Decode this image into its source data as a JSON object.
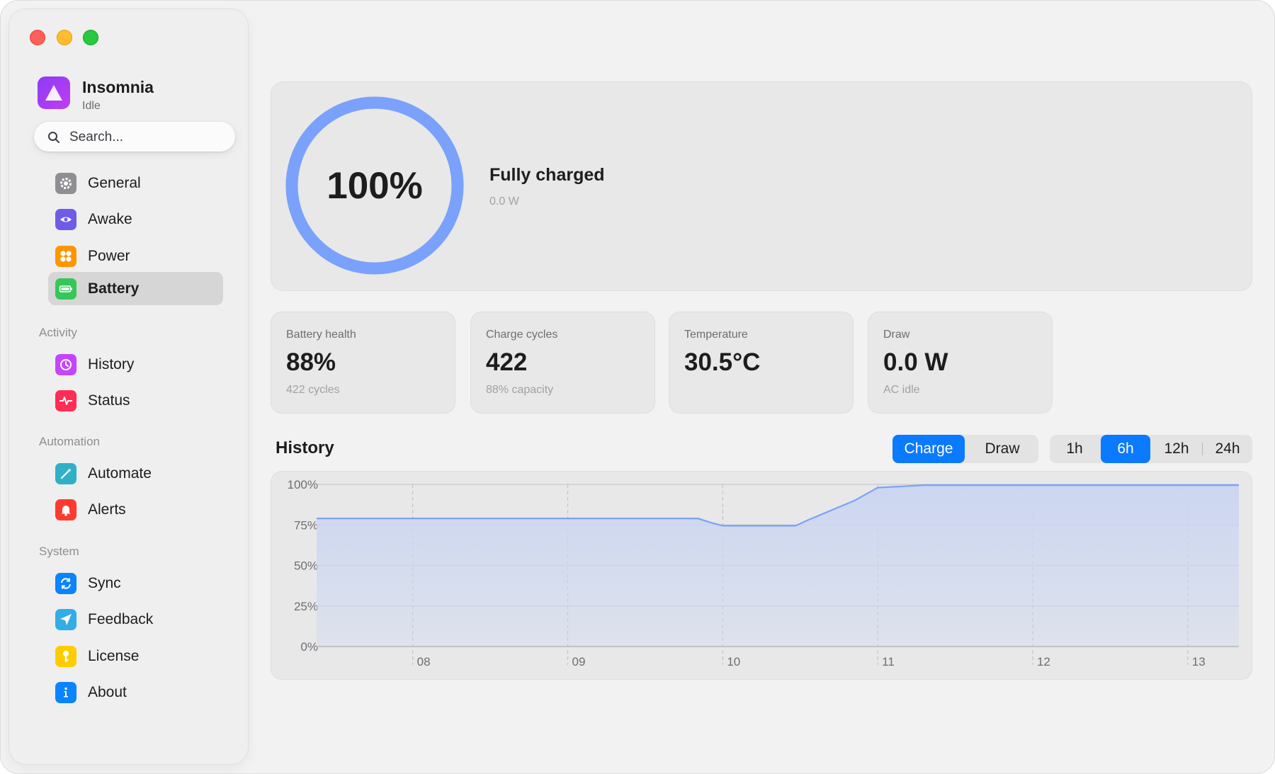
{
  "app": {
    "name": "Insomnia",
    "status": "Idle"
  },
  "search": {
    "placeholder": "Search..."
  },
  "nav": {
    "main": [
      {
        "label": "General",
        "icon": "gear-icon",
        "color": "#8e8e93"
      },
      {
        "label": "Awake",
        "icon": "eye-icon",
        "color": "#6e5ce6"
      },
      {
        "label": "Power",
        "icon": "power-icon",
        "color": "#ff9500"
      },
      {
        "label": "Battery",
        "icon": "battery-icon",
        "color": "#34c759",
        "active": true
      }
    ],
    "activity_label": "Activity",
    "activity": [
      {
        "label": "History",
        "icon": "clock-icon",
        "color": "#c644fc"
      },
      {
        "label": "Status",
        "icon": "pulse-icon",
        "color": "#ff2d55"
      }
    ],
    "automation_label": "Automation",
    "automation": [
      {
        "label": "Automate",
        "icon": "wand-icon",
        "color": "#30b0c7"
      },
      {
        "label": "Alerts",
        "icon": "bell-icon",
        "color": "#ff3b30"
      }
    ],
    "system_label": "System",
    "system": [
      {
        "label": "Sync",
        "icon": "sync-icon",
        "color": "#0a84ff"
      },
      {
        "label": "Feedback",
        "icon": "paper-plane-icon",
        "color": "#32ade6"
      },
      {
        "label": "License",
        "icon": "key-icon",
        "color": "#ffcc00"
      },
      {
        "label": "About",
        "icon": "info-icon",
        "color": "#0a84ff"
      }
    ]
  },
  "hero": {
    "percent": "100%",
    "level": 1.0,
    "title": "Fully charged",
    "power": "0.0 W",
    "ring_color": "#7aa1fb"
  },
  "cards": [
    {
      "label": "Battery health",
      "value": "88%",
      "sub": "422 cycles"
    },
    {
      "label": "Charge cycles",
      "value": "422",
      "sub": "88% capacity"
    },
    {
      "label": "Temperature",
      "value": "30.5°C",
      "sub": ""
    },
    {
      "label": "Draw",
      "value": "0.0 W",
      "sub": "AC idle"
    }
  ],
  "history": {
    "title": "History",
    "mode_tabs": [
      {
        "label": "Charge",
        "active": true
      },
      {
        "label": "Draw",
        "active": false
      }
    ],
    "range_tabs": [
      {
        "label": "1h",
        "active": false
      },
      {
        "label": "6h",
        "active": true
      },
      {
        "label": "12h",
        "active": false
      },
      {
        "label": "24h",
        "active": false
      }
    ]
  },
  "colors": {
    "accent": "#0a7aff",
    "series": "#7aa1fb",
    "fill": "#cbd6f1"
  },
  "chart_data": {
    "type": "area",
    "title": "",
    "xlabel": "",
    "ylabel": "",
    "ylim": [
      0,
      100
    ],
    "y_ticks": [
      "0%",
      "25%",
      "50%",
      "75%",
      "100%"
    ],
    "x_ticks": [
      {
        "label": "08",
        "t": 8.0
      },
      {
        "label": "09",
        "t": 9.0
      },
      {
        "label": "10",
        "t": 10.0
      },
      {
        "label": "11",
        "t": 11.0
      },
      {
        "label": "12",
        "t": 12.0
      },
      {
        "label": "13",
        "t": 13.0
      }
    ],
    "xlim": [
      7.38,
      13.33
    ],
    "grid": true,
    "series": [
      {
        "points": [
          [
            7.38,
            79
          ],
          [
            9.84,
            79
          ],
          [
            9.92,
            76.5
          ],
          [
            10.0,
            74.5
          ],
          [
            10.47,
            74.5
          ],
          [
            10.55,
            78
          ],
          [
            10.7,
            84
          ],
          [
            10.85,
            90
          ],
          [
            11.0,
            98
          ],
          [
            11.3,
            99.5
          ],
          [
            13.33,
            99.5
          ]
        ]
      }
    ]
  }
}
